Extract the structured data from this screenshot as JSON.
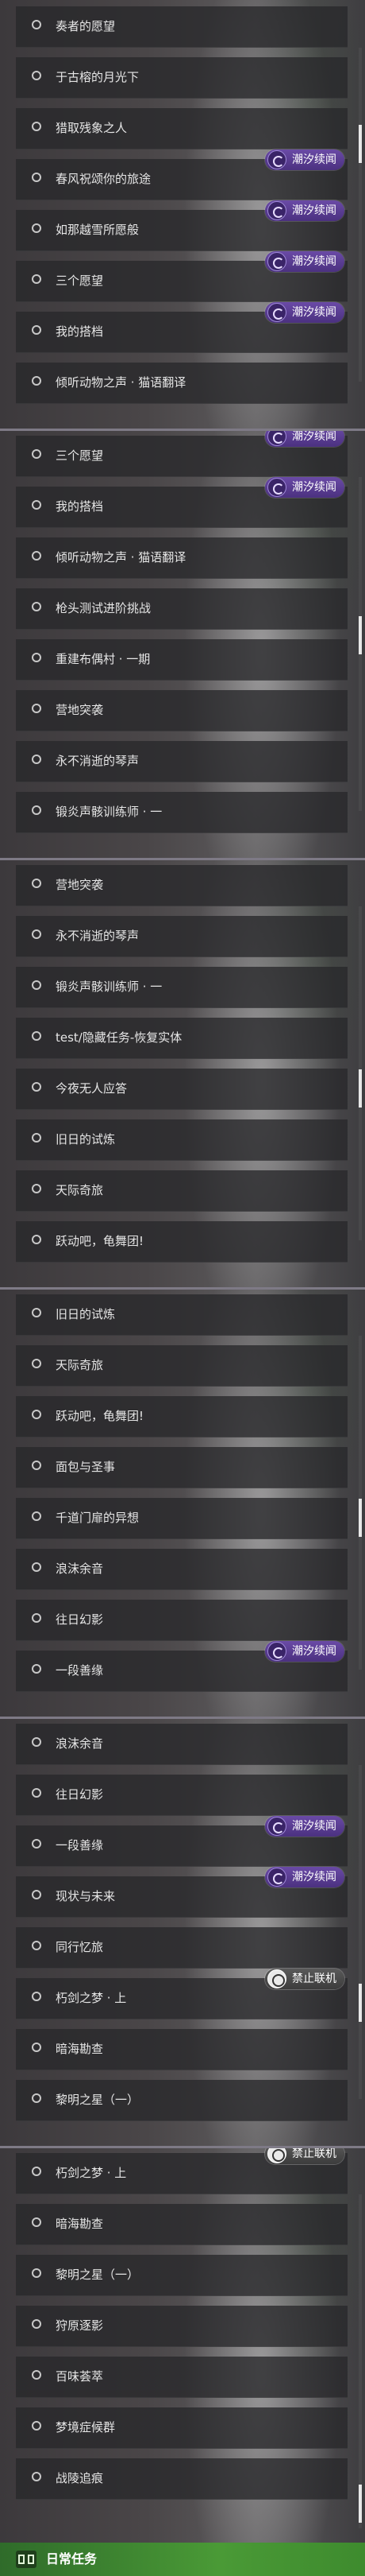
{
  "badges": {
    "chaoxi": "潮汐续闻",
    "no_coop": "禁止联机"
  },
  "panels": [
    {
      "items": [
        {
          "label": "奏者的愿望"
        },
        {
          "label": "于古榕的月光下"
        },
        {
          "label": "猎取残象之人"
        },
        {
          "label": "春风祝颂你的旅途",
          "badge": "chaoxi"
        },
        {
          "label": "如那越雪所愿般",
          "badge": "chaoxi"
        },
        {
          "label": "三个愿望",
          "badge": "chaoxi"
        },
        {
          "label": "我的搭档",
          "badge": "chaoxi"
        },
        {
          "label": "倾听动物之声 · 猫语翻译"
        }
      ]
    },
    {
      "items": [
        {
          "label": "三个愿望",
          "badge": "chaoxi"
        },
        {
          "label": "我的搭档",
          "badge": "chaoxi"
        },
        {
          "label": "倾听动物之声 · 猫语翻译"
        },
        {
          "label": "枪头测试进阶挑战"
        },
        {
          "label": "重建布偶村 · 一期"
        },
        {
          "label": "营地突袭"
        },
        {
          "label": "永不消逝的琴声"
        },
        {
          "label": "锻炎声骸训练师 · 一"
        }
      ]
    },
    {
      "items": [
        {
          "label": "营地突袭"
        },
        {
          "label": "永不消逝的琴声"
        },
        {
          "label": "锻炎声骸训练师 · 一"
        },
        {
          "label": "test/隐藏任务-恢复实体"
        },
        {
          "label": "今夜无人应答"
        },
        {
          "label": "旧日的试炼"
        },
        {
          "label": "天际奇旅"
        },
        {
          "label": "跃动吧，龟舞团!"
        }
      ]
    },
    {
      "items": [
        {
          "label": "旧日的试炼"
        },
        {
          "label": "天际奇旅"
        },
        {
          "label": "跃动吧，龟舞团!"
        },
        {
          "label": "面包与圣事"
        },
        {
          "label": "千道门扉的异想"
        },
        {
          "label": "浪沫余音"
        },
        {
          "label": "往日幻影"
        },
        {
          "label": "一段善缘",
          "badge": "chaoxi"
        }
      ]
    },
    {
      "items": [
        {
          "label": "浪沫余音"
        },
        {
          "label": "往日幻影"
        },
        {
          "label": "一段善缘",
          "badge": "chaoxi"
        },
        {
          "label": "现状与未来",
          "badge": "chaoxi"
        },
        {
          "label": "同行忆旅"
        },
        {
          "label": "朽剑之梦 · 上",
          "badge": "no_coop"
        },
        {
          "label": "暗海勘查"
        },
        {
          "label": "黎明之星（一）"
        }
      ]
    },
    {
      "items": [
        {
          "label": "朽剑之梦 · 上",
          "badge": "no_coop"
        },
        {
          "label": "暗海勘查"
        },
        {
          "label": "黎明之星（一）"
        },
        {
          "label": "狩原逐影"
        },
        {
          "label": "百味荟萃"
        },
        {
          "label": "梦境症候群"
        },
        {
          "label": "战陵追痕"
        }
      ]
    }
  ],
  "scroll": [
    0.26,
    0.47,
    0.55,
    0.55,
    0.74,
    0.98
  ],
  "footer": {
    "title": "日常任务"
  }
}
